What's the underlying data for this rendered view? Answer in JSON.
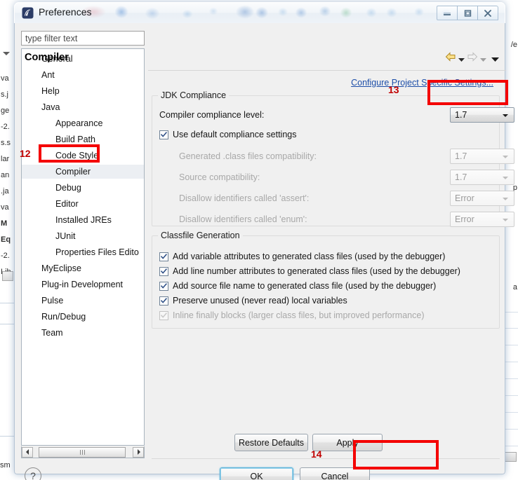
{
  "window": {
    "title": "Preferences",
    "icon": "eclipse-icon",
    "controls": [
      {
        "name": "minimize-button",
        "glyph": "minimize-icon"
      },
      {
        "name": "maximize-button",
        "glyph": "maximize-icon"
      },
      {
        "name": "close-button",
        "glyph": "close-icon"
      }
    ]
  },
  "filter": {
    "placeholder": "type filter text",
    "value": ""
  },
  "tree": {
    "items": [
      {
        "label": "General",
        "indent": 0,
        "selected": false
      },
      {
        "label": "Ant",
        "indent": 0,
        "selected": false
      },
      {
        "label": "Help",
        "indent": 0,
        "selected": false
      },
      {
        "label": "Java",
        "indent": 0,
        "selected": false
      },
      {
        "label": "Appearance",
        "indent": 1,
        "selected": false
      },
      {
        "label": "Build Path",
        "indent": 1,
        "selected": false
      },
      {
        "label": "Code Style",
        "indent": 1,
        "selected": false
      },
      {
        "label": "Compiler",
        "indent": 1,
        "selected": true
      },
      {
        "label": "Debug",
        "indent": 1,
        "selected": false
      },
      {
        "label": "Editor",
        "indent": 1,
        "selected": false
      },
      {
        "label": "Installed JREs",
        "indent": 1,
        "selected": false
      },
      {
        "label": "JUnit",
        "indent": 1,
        "selected": false
      },
      {
        "label": "Properties Files Edito",
        "indent": 1,
        "selected": false
      },
      {
        "label": "MyEclipse",
        "indent": 0,
        "selected": false
      },
      {
        "label": "Plug-in Development",
        "indent": 0,
        "selected": false
      },
      {
        "label": "Pulse",
        "indent": 0,
        "selected": false
      },
      {
        "label": "Run/Debug",
        "indent": 0,
        "selected": false
      },
      {
        "label": "Team",
        "indent": 0,
        "selected": false
      }
    ]
  },
  "page": {
    "title": "Compiler",
    "configure_link": "Configure Project Specific Settings...",
    "nav": [
      {
        "name": "back-arrow-icon",
        "enabled": true
      },
      {
        "name": "back-dropdown-icon",
        "enabled": true
      },
      {
        "name": "forward-arrow-icon",
        "enabled": false
      },
      {
        "name": "forward-dropdown-icon",
        "enabled": false
      },
      {
        "name": "menu-chevron-icon",
        "enabled": true
      }
    ]
  },
  "jdk_compliance": {
    "title": "JDK Compliance",
    "compliance_level_label": "Compiler compliance level:",
    "compliance_level_value": "1.7",
    "use_default_label": "Use default compliance settings",
    "use_default_checked": true,
    "rows": [
      {
        "label": "Generated .class files compatibility:",
        "value": "1.7",
        "enabled": false
      },
      {
        "label": "Source compatibility:",
        "value": "1.7",
        "enabled": false
      },
      {
        "label": "Disallow identifiers called 'assert':",
        "value": "Error",
        "enabled": false
      },
      {
        "label": "Disallow identifiers called 'enum':",
        "value": "Error",
        "enabled": false
      }
    ]
  },
  "classfile_generation": {
    "title": "Classfile Generation",
    "options": [
      {
        "label": "Add variable attributes to generated class files (used by the debugger)",
        "checked": true,
        "enabled": true
      },
      {
        "label": "Add line number attributes to generated class files (used by the debugger)",
        "checked": true,
        "enabled": true
      },
      {
        "label": "Add source file name to generated class file (used by the debugger)",
        "checked": true,
        "enabled": true
      },
      {
        "label": "Preserve unused (never read) local variables",
        "checked": true,
        "enabled": true
      },
      {
        "label": "Inline finally blocks (larger class files, but improved performance)",
        "checked": true,
        "enabled": false
      }
    ]
  },
  "buttons": {
    "restore_defaults": "Restore Defaults",
    "apply": "Apply",
    "ok": "OK",
    "cancel": "Cancel",
    "help_icon": "help-question-icon"
  },
  "annotations": {
    "accent_color": "#f40000",
    "number_color": "#c00000",
    "marks": [
      {
        "number": "12",
        "target": "compiler-tree-item"
      },
      {
        "number": "13",
        "target": "compliance-level-combo"
      },
      {
        "number": "14",
        "target": "ok-button"
      }
    ]
  },
  "background": {
    "left_fragments": [
      "va",
      "s.j",
      "ge",
      "-2.",
      "s.s",
      "lar",
      "an",
      ".ja",
      "va",
      "M",
      "Eq",
      "-2.",
      "Lib"
    ],
    "right_fragments": [
      "/e",
      "p",
      "a"
    ],
    "bottom_fragment": "sm"
  }
}
